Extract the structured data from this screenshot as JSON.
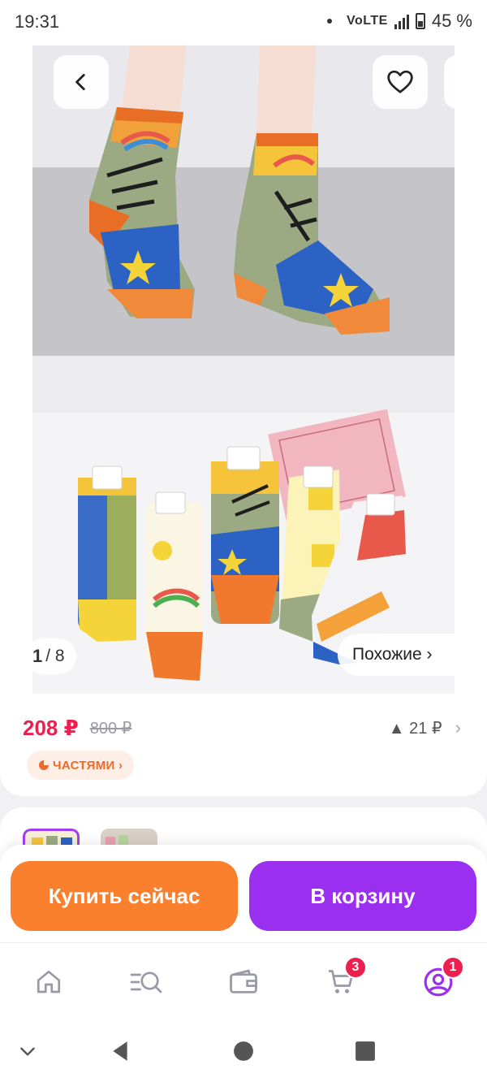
{
  "status_bar": {
    "time": "19:31",
    "network": "VoLTE",
    "battery": "45 %"
  },
  "gallery": {
    "counter_current": "1",
    "counter_total": "/ 8",
    "similar_label": "Похожие ›",
    "photo_top_label": "",
    "photo_bottom_label": ""
  },
  "price": {
    "current": "208 ₽",
    "old": "800 ₽",
    "change": "▲ 21 ₽"
  },
  "installment": {
    "label": "ЧАСТЯМИ ›"
  },
  "actions": {
    "buy_now": "Купить сейчас",
    "add_to_cart": "В корзину"
  },
  "tab_bar": {
    "cart_badge": "3",
    "profile_badge": "1"
  },
  "colors": {
    "price_accent": "#ec1f4e",
    "buy_button": "#fa802d",
    "cart_button": "#9b2ff0",
    "tab_active": "#9b2ff0"
  }
}
